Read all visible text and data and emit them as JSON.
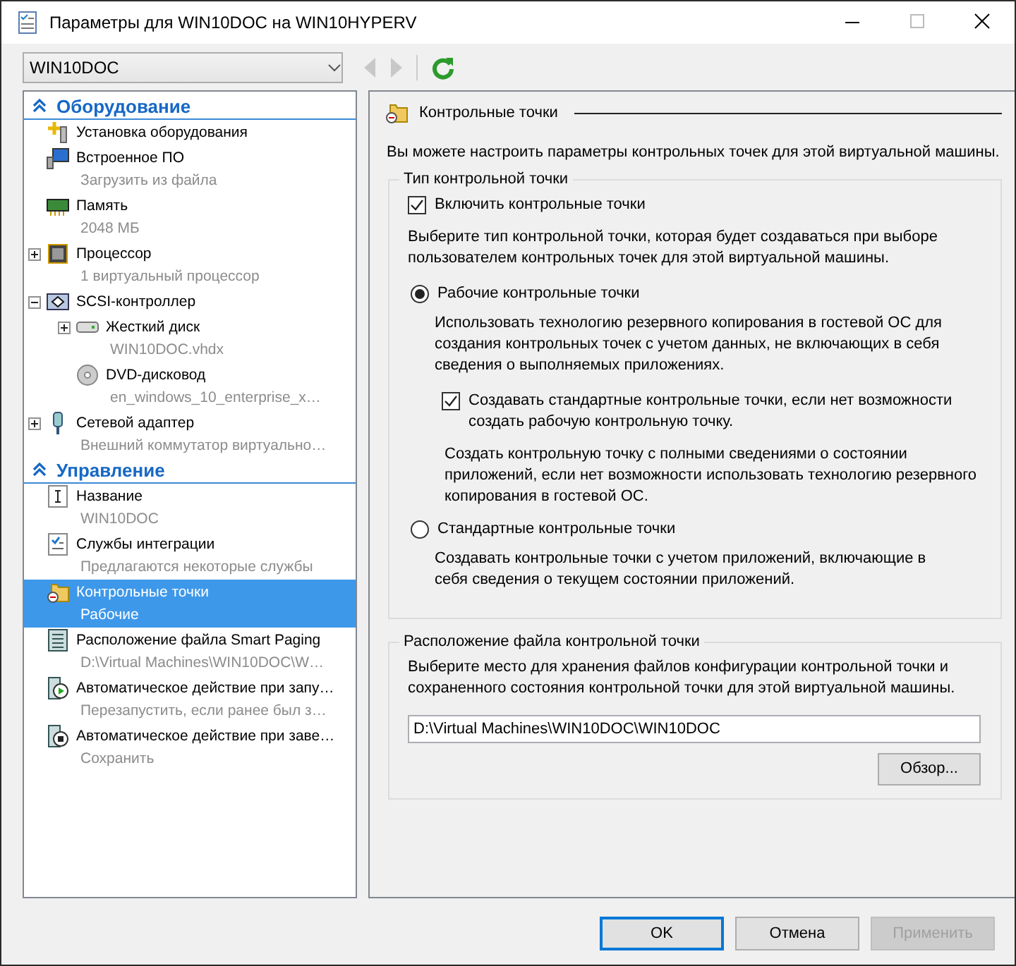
{
  "window": {
    "title": "Параметры для WIN10DOC на WIN10HYPERV"
  },
  "toolbar": {
    "vm_selector": {
      "value": "WIN10DOC"
    },
    "nav": [
      {
        "kind": "back",
        "disabled": true
      },
      {
        "kind": "forward",
        "disabled": true
      },
      {
        "kind": "refresh",
        "disabled": false
      }
    ]
  },
  "sidebar": {
    "sections": [
      {
        "title": "Оборудование",
        "expanded": true,
        "items": [
          {
            "kind": "hardware-add",
            "label": "Установка оборудования",
            "selected": false
          },
          {
            "kind": "firmware",
            "label": "Встроенное ПО",
            "detail": "Загрузить из файла",
            "selected": false
          },
          {
            "kind": "memory",
            "label": "Память",
            "detail": "2048 МБ",
            "selected": false
          },
          {
            "kind": "processor",
            "label": "Процессор",
            "detail": "1 виртуальный процессор",
            "expanded": false,
            "selected": false
          },
          {
            "kind": "scsi",
            "label": "SCSI-контроллер",
            "expanded": true,
            "selected": false,
            "children": [
              {
                "kind": "disk",
                "label": "Жесткий диск",
                "detail": "WIN10DOC.vhdx",
                "expanded": false,
                "selected": false
              },
              {
                "kind": "dvd",
                "label": "DVD-дисковод",
                "detail": "en_windows_10_enterprise_x…",
                "selected": false
              }
            ]
          },
          {
            "kind": "network",
            "label": "Сетевой адаптер",
            "detail": "Внешний коммутатор виртуально…",
            "expanded": false,
            "selected": false
          }
        ]
      },
      {
        "title": "Управление",
        "expanded": true,
        "items": [
          {
            "kind": "name",
            "label": "Название",
            "detail": "WIN10DOC",
            "selected": false
          },
          {
            "kind": "integration",
            "label": "Службы интеграции",
            "detail": "Предлагаются некоторые службы",
            "selected": false
          },
          {
            "kind": "checkpoint",
            "label": "Контрольные точки",
            "detail": "Рабочие",
            "selected": true
          },
          {
            "kind": "paging",
            "label": "Расположение файла Smart Paging",
            "detail": "D:\\Virtual Machines\\WIN10DOC\\W…",
            "selected": false
          },
          {
            "kind": "autostart",
            "label": "Автоматическое действие при запу…",
            "detail": "Перезапустить, если ранее был з…",
            "selected": false
          },
          {
            "kind": "autostop",
            "label": "Автоматическое действие при заве…",
            "detail": "Сохранить",
            "selected": false
          }
        ]
      }
    ]
  },
  "panel": {
    "title": "Контрольные точки",
    "intro": "Вы можете настроить параметры контрольных точек для этой виртуальной машины.",
    "checkpoint_type": {
      "legend": "Тип контрольной точки",
      "enable": {
        "label": "Включить контрольные точки",
        "checked": true
      },
      "hint": "Выберите тип контрольной точки, которая будет создаваться при выборе пользователем контрольных точек для этой виртуальной машины.",
      "options": [
        {
          "label": "Рабочие контрольные точки",
          "selected": true,
          "description": "Использовать технологию резервного копирования в гостевой ОС для создания контрольных точек с учетом данных, не включающих в себя сведения о выполняемых приложениях.",
          "fallback": {
            "label": "Создавать стандартные контрольные точки, если нет возможности создать рабочую контрольную точку.",
            "checked": true,
            "description": "Создать контрольную точку с полными сведениями о состоянии приложений, если нет возможности использовать технологию резервного копирования в гостевой ОС."
          }
        },
        {
          "label": "Стандартные контрольные точки",
          "selected": false,
          "description": "Создавать контрольные точки с учетом приложений, включающие в себя сведения о текущем состоянии приложений."
        }
      ]
    },
    "location": {
      "legend": "Расположение файла контрольной точки",
      "hint": "Выберите место для хранения файлов конфигурации контрольной точки и сохраненного состояния контрольной точки для этой виртуальной машины.",
      "value": "D:\\Virtual Machines\\WIN10DOC\\WIN10DOC",
      "browse": "Обзор..."
    }
  },
  "buttons": [
    {
      "label": "OK",
      "default": true,
      "disabled": false
    },
    {
      "label": "Отмена",
      "default": false,
      "disabled": false
    },
    {
      "label": "Применить",
      "default": false,
      "disabled": true
    }
  ]
}
